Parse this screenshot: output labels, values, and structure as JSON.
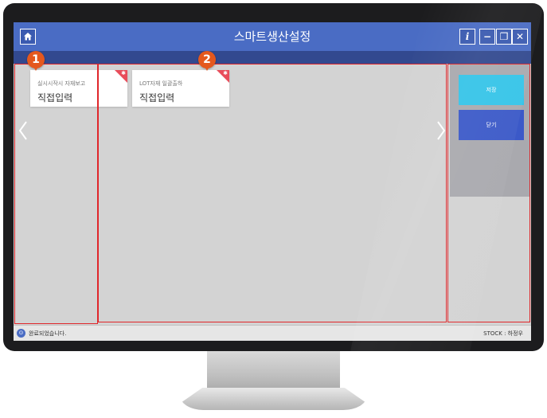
{
  "window": {
    "title": "스마트생산설정",
    "info_label": "i",
    "minimize_label": "−",
    "restore_label": "❐",
    "close_label": "✕"
  },
  "markers": [
    "1",
    "2"
  ],
  "cards": [
    {
      "title": "실시시작시 자재보고",
      "value": "직접입력"
    },
    {
      "title": "LOT자재 일괄출하",
      "value": "직접입력"
    }
  ],
  "actions": {
    "save_label": "저장",
    "close_label": "닫기"
  },
  "status": {
    "message": "완료되었습니다.",
    "right": "STOCK : 하정우"
  },
  "colors": {
    "titlebar": "#4a6cc4",
    "subbar": "#32498f",
    "save": "#35c4e8",
    "close": "#3b59c8",
    "outline": "#e0262a",
    "marker": "#e4581e"
  },
  "icons": [
    "home-icon",
    "info-icon",
    "minimize-icon",
    "restore-icon",
    "close-icon",
    "chevron-left-icon",
    "chevron-right-icon",
    "status-info-icon"
  ]
}
